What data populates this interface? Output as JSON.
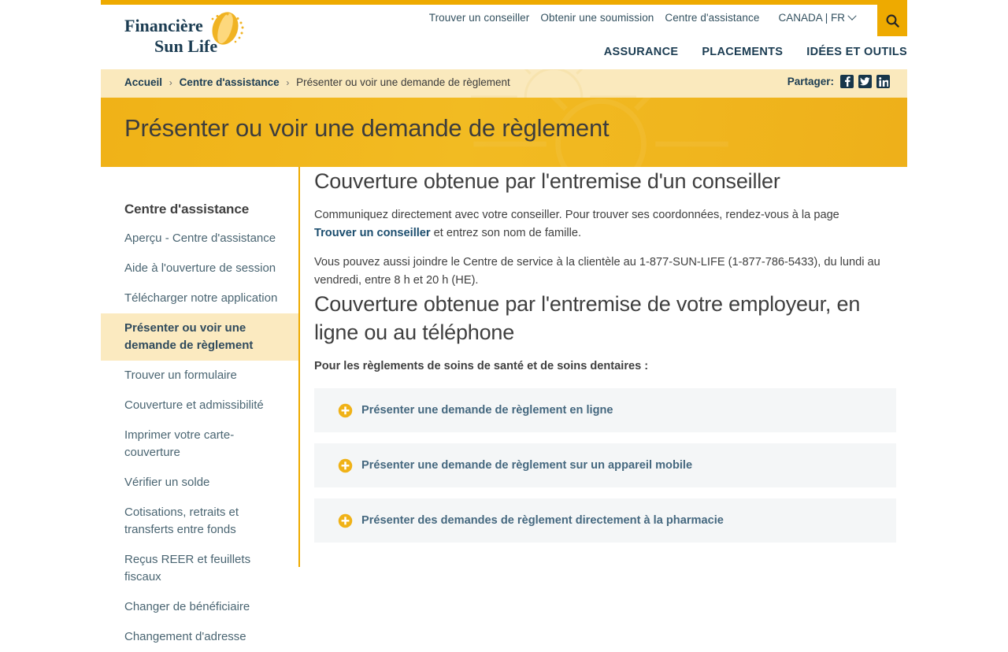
{
  "brand": {
    "logo_line1": "Financière",
    "logo_line2": "Sun Life",
    "accent_gold": "#eeaa00",
    "banner_gold": "#f0b217",
    "crumb_bg": "#fae9bd",
    "navy": "#1b3c52",
    "link_blue": "#45687f"
  },
  "header": {
    "utility_links": [
      {
        "label": "Trouver un conseiller",
        "name": "util-link-trouver-un-conseiller"
      },
      {
        "label": "Obtenir une soumission",
        "name": "util-link-obtenir-une-soumission"
      },
      {
        "label": "Centre d'assistance",
        "name": "util-link-centre-dassistance"
      }
    ],
    "locale": "CANADA | FR",
    "locale_icon": "chevron-down-icon",
    "search_icon": "search-icon",
    "main_nav": [
      {
        "label": "ASSURANCE",
        "name": "nav-assurance"
      },
      {
        "label": "PLACEMENTS",
        "name": "nav-placements"
      },
      {
        "label": "IDÉES ET OUTILS",
        "name": "nav-idees-et-outils"
      }
    ]
  },
  "breadcrumb": {
    "items": [
      {
        "label": "Accueil",
        "link": true
      },
      {
        "label": "Centre d'assistance",
        "link": true
      },
      {
        "label": "Présenter ou voir une demande de règlement",
        "link": false
      }
    ],
    "separator": "›",
    "share_label": "Partager:",
    "share_icons": [
      {
        "name": "facebook-icon",
        "glyph": "f"
      },
      {
        "name": "twitter-icon",
        "glyph": "t"
      },
      {
        "name": "linkedin-icon",
        "glyph": "in"
      }
    ]
  },
  "hero": {
    "title": "Présenter ou voir une demande de règlement"
  },
  "sidebar": {
    "title": "Centre d'assistance",
    "items": [
      {
        "label": "Aperçu - Centre d'assistance",
        "active": false
      },
      {
        "label": "Aide à l'ouverture de session",
        "active": false
      },
      {
        "label": "Télécharger notre application",
        "active": false
      },
      {
        "label": "Présenter ou voir une demande de règlement",
        "active": true
      },
      {
        "label": "Trouver un formulaire",
        "active": false
      },
      {
        "label": "Couverture et admissibilité",
        "active": false
      },
      {
        "label": "Imprimer votre carte-couverture",
        "active": false
      },
      {
        "label": "Vérifier un solde",
        "active": false
      },
      {
        "label": "Cotisations, retraits et transferts entre fonds",
        "active": false
      },
      {
        "label": "Reçus REER et feuillets fiscaux",
        "active": false
      },
      {
        "label": "Changer de bénéficiaire",
        "active": false
      },
      {
        "label": "Changement d'adresse",
        "active": false
      }
    ]
  },
  "main": {
    "heading_1": "Couverture obtenue par l'entremise d'un conseiller",
    "paragraph_1_pre": "Communiquez directement avec votre conseiller. Pour trouver ses coordonnées, rendez-vous à la page ",
    "paragraph_1_link": "Trouver un conseiller",
    "paragraph_1_post": " et entrez son nom de famille.",
    "paragraph_2": "Vous pouvez aussi joindre le Centre de service à la clientèle au 1-877-SUN-LIFE (1-877-786-5433), du lundi au vendredi, entre 8 h et 20 h (HE).",
    "heading_2": "Couverture obtenue par l'entremise de votre employeur, en ligne ou au téléphone",
    "sub_heading": "Pour les règlements de soins de santé et de soins dentaires :",
    "accordion": [
      {
        "label": "Présenter une demande de règlement en ligne",
        "icon": "plus-circle-icon",
        "expanded": false
      },
      {
        "label": "Présenter une demande de règlement sur un appareil mobile",
        "icon": "plus-circle-icon",
        "expanded": false
      },
      {
        "label": "Présenter des demandes de règlement directement à la pharmacie",
        "icon": "plus-circle-icon",
        "expanded": false
      }
    ]
  }
}
